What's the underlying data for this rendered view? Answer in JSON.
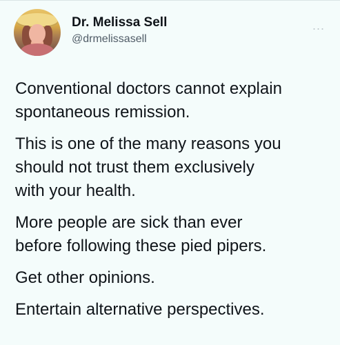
{
  "author": {
    "display_name": "Dr. Melissa Sell",
    "handle": "@drmelissasell",
    "avatar_icon": "profile-photo"
  },
  "menu": {
    "more_label": "..."
  },
  "tweet": {
    "paragraphs": [
      "Conventional doctors cannot explain\nspontaneous remission.",
      "This is one of the many reasons you\nshould not trust them exclusively\nwith your health.",
      "More people are sick than ever\nbefore following these pied pipers.",
      "Get other opinions.",
      "Entertain alternative perspectives."
    ]
  },
  "colors": {
    "background": "#f4fcfb",
    "text": "#0f1419",
    "secondary_text": "#4f5b66"
  }
}
